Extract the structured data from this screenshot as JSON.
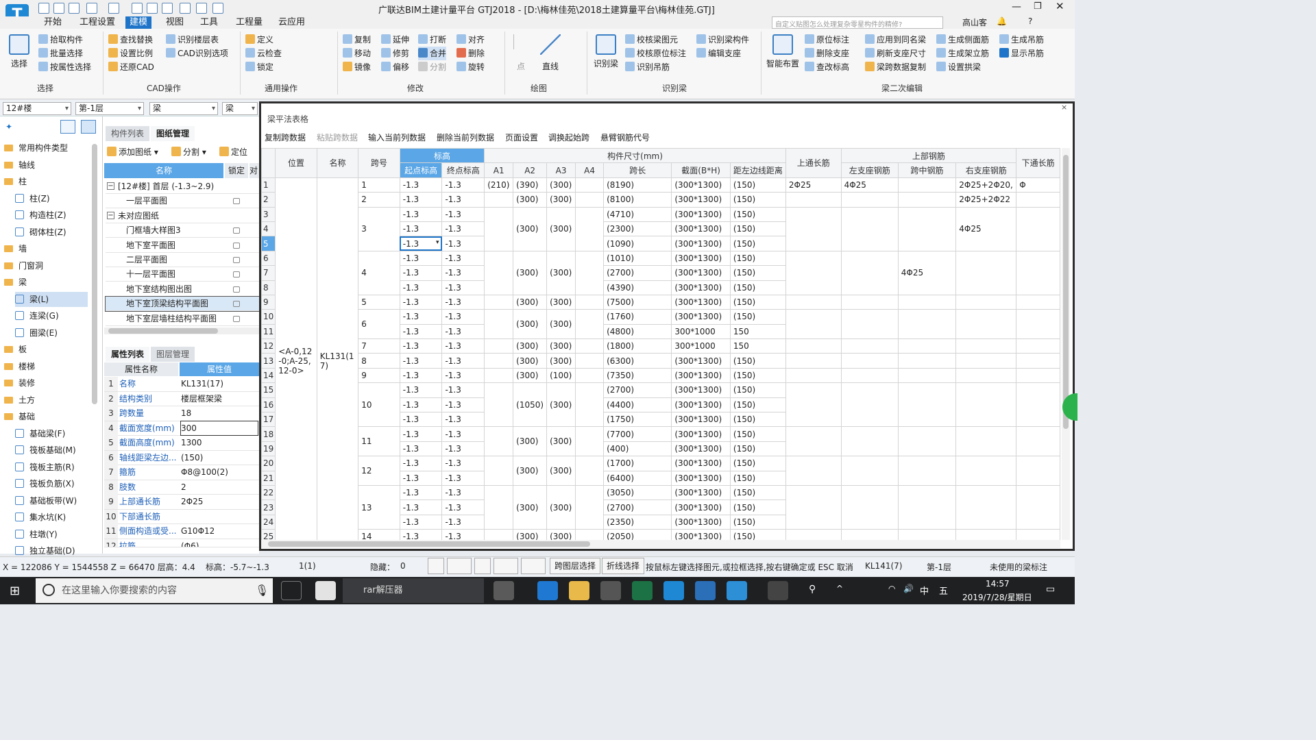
{
  "window": {
    "title": "广联达BIM土建计量平台 GTJ2018 - [D:\\梅林佳苑\\2018土建算量平台\\梅林佳苑.GTJ]",
    "logo": "T",
    "search_placeholder": "自定义贴图怎么处理复杂零星构件的精修?",
    "user": "高山客"
  },
  "menu": [
    "开始",
    "工程设置",
    "建模",
    "视图",
    "工具",
    "工程量",
    "云应用"
  ],
  "ribbon": {
    "select_big": "选择",
    "col1": [
      "拾取构件",
      "批量选择",
      "按属性选择"
    ],
    "col2": [
      "查找替换",
      "设置比例",
      "还原CAD"
    ],
    "col3": [
      "识别楼层表",
      "CAD识别选项"
    ],
    "col4": [
      "定义",
      "云检查",
      "锁定"
    ],
    "col5": [
      "复制",
      "移动",
      "镜像"
    ],
    "col6": [
      "延伸",
      "修剪",
      "偏移"
    ],
    "col7": [
      "打断",
      "合并",
      "分割"
    ],
    "col8": [
      "对齐",
      "删除",
      "旋转"
    ],
    "draw": [
      "点",
      "直线"
    ],
    "recog_beam_big": "识别梁",
    "col9": [
      "校核梁图元",
      "校核原位标注",
      "识别吊筋"
    ],
    "col10": [
      "识别梁构件",
      "编辑支座"
    ],
    "smart_big": "智能布置",
    "col11": [
      "原位标注",
      "删除支座",
      "查改标高"
    ],
    "col12": [
      "应用到同名梁",
      "刷新支座尺寸",
      "梁跨数据复制"
    ],
    "col13": [
      "生成侧面筋",
      "生成架立筋",
      "设置拱梁"
    ],
    "col14": [
      "生成吊筋",
      "显示吊筋"
    ],
    "groups": [
      "选择",
      "CAD操作",
      "通用操作",
      "修改",
      "绘图",
      "识别梁",
      "梁二次编辑"
    ]
  },
  "toolbar": {
    "floor": "12#楼",
    "layer": "第-1层",
    "type": "梁",
    "type2": "梁"
  },
  "tree": [
    {
      "label": "常用构件类型",
      "kind": "folder"
    },
    {
      "label": "轴线",
      "kind": "folder"
    },
    {
      "label": "柱",
      "kind": "folder"
    },
    {
      "label": "柱(Z)",
      "kind": "item"
    },
    {
      "label": "构造柱(Z)",
      "kind": "item"
    },
    {
      "label": "砌体柱(Z)",
      "kind": "item"
    },
    {
      "label": "墙",
      "kind": "folder"
    },
    {
      "label": "门窗洞",
      "kind": "folder"
    },
    {
      "label": "梁",
      "kind": "folder"
    },
    {
      "label": "梁(L)",
      "kind": "item",
      "selected": true
    },
    {
      "label": "连梁(G)",
      "kind": "item"
    },
    {
      "label": "圈梁(E)",
      "kind": "item"
    },
    {
      "label": "板",
      "kind": "folder"
    },
    {
      "label": "楼梯",
      "kind": "folder"
    },
    {
      "label": "装修",
      "kind": "folder"
    },
    {
      "label": "土方",
      "kind": "folder"
    },
    {
      "label": "基础",
      "kind": "folder"
    },
    {
      "label": "基础梁(F)",
      "kind": "item"
    },
    {
      "label": "筏板基础(M)",
      "kind": "item"
    },
    {
      "label": "筏板主筋(R)",
      "kind": "item"
    },
    {
      "label": "筏板负筋(X)",
      "kind": "item"
    },
    {
      "label": "基础板带(W)",
      "kind": "item"
    },
    {
      "label": "集水坑(K)",
      "kind": "item"
    },
    {
      "label": "柱墩(Y)",
      "kind": "item"
    },
    {
      "label": "独立基础(D)",
      "kind": "item"
    }
  ],
  "drawings": {
    "tabs": [
      "构件列表",
      "图纸管理"
    ],
    "actions": [
      "添加图纸",
      "分割",
      "定位"
    ],
    "headers": [
      "名称",
      "锁定",
      "对"
    ],
    "rows": [
      {
        "label": "[12#楼] 首层 (-1.3~2.9)",
        "group": true
      },
      {
        "label": "一层平面图"
      },
      {
        "label": "未对应图纸",
        "group": true
      },
      {
        "label": "门框墙大样图3"
      },
      {
        "label": "地下室平面图"
      },
      {
        "label": "二层平面图"
      },
      {
        "label": "十一层平面图"
      },
      {
        "label": "地下室结构图出图"
      },
      {
        "label": "地下室顶梁结构平面图"
      },
      {
        "label": "地下室层墙柱结构平面图"
      }
    ]
  },
  "props": {
    "tabs": [
      "属性列表",
      "图层管理"
    ],
    "headers": [
      "属性名称",
      "属性值"
    ],
    "rows": [
      {
        "n": "1",
        "k": "名称",
        "v": "KL131(17)"
      },
      {
        "n": "2",
        "k": "结构类别",
        "v": "楼层框架梁"
      },
      {
        "n": "3",
        "k": "跨数量",
        "v": "18"
      },
      {
        "n": "4",
        "k": "截面宽度(mm)",
        "v": "300"
      },
      {
        "n": "5",
        "k": "截面高度(mm)",
        "v": "1300"
      },
      {
        "n": "6",
        "k": "轴线距梁左边...",
        "v": "(150)"
      },
      {
        "n": "7",
        "k": "箍筋",
        "v": "Φ8@100(2)"
      },
      {
        "n": "8",
        "k": "肢数",
        "v": "2"
      },
      {
        "n": "9",
        "k": "上部通长筋",
        "v": "2Φ25"
      },
      {
        "n": "10",
        "k": "下部通长筋",
        "v": ""
      },
      {
        "n": "11",
        "k": "侧面构造或受...",
        "v": "G10Φ12"
      },
      {
        "n": "12",
        "k": "拉筋",
        "v": "(Φ6)"
      }
    ]
  },
  "dialog": {
    "title": "梁平法表格",
    "buttons": [
      "复制跨数据",
      "粘贴跨数据",
      "输入当前列数据",
      "删除当前列数据",
      "页面设置",
      "调换起始跨",
      "悬臂钢筋代号"
    ],
    "header1": {
      "pos": "位置",
      "name": "名称",
      "span": "跨号",
      "elev": "标高",
      "dims": "构件尺寸(mm)",
      "top_long": "上通长筋",
      "top_rebar": "上部钢筋"
    },
    "header2": [
      "起点标高",
      "终点标高",
      "A1",
      "A2",
      "A3",
      "A4",
      "跨长",
      "截面(B*H)",
      "距左边线距离",
      "左支座钢筋",
      "跨中钢筋",
      "右支座钢筋",
      "下通长筋"
    ],
    "position": "<A-0,12-0;A-25,12-0>",
    "beam_name": "KL131(17)",
    "rows": [
      {
        "r": "1",
        "span": "1",
        "s": "-1.3",
        "e": "-1.3",
        "a1": "(210)",
        "a2": "(390)",
        "a3": "(300)",
        "len": "(8190)",
        "sec": "(300*1300)",
        "dist": "(150)",
        "tl": "2Φ25",
        "ls": "4Φ25",
        "mid": "",
        "rs": "2Φ25+2Φ20,",
        "bl": "Φ"
      },
      {
        "r": "2",
        "span": "2",
        "s": "-1.3",
        "e": "-1.3",
        "a2": "(300)",
        "a3": "(300)",
        "len": "(8100)",
        "sec": "(300*1300)",
        "dist": "(150)",
        "rs": "2Φ25+2Φ22"
      },
      {
        "r": "3",
        "s": "-1.3",
        "e": "-1.3",
        "len": "(4710)",
        "sec": "(300*1300)",
        "dist": "(150)"
      },
      {
        "r": "4",
        "span": "3",
        "s": "-1.3",
        "e": "-1.3",
        "a2": "(300)",
        "a3": "(300)",
        "len": "(2300)",
        "sec": "(300*1300)",
        "dist": "(150)",
        "rs": "4Φ25"
      },
      {
        "r": "5",
        "s": "-1.3",
        "e": "-1.3",
        "len": "(1090)",
        "sec": "(300*1300)",
        "dist": "(150)",
        "editing": true
      },
      {
        "r": "6",
        "s": "-1.3",
        "e": "-1.3",
        "len": "(1010)",
        "sec": "(300*1300)",
        "dist": "(150)"
      },
      {
        "r": "7",
        "span": "4",
        "s": "-1.3",
        "e": "-1.3",
        "a2": "(300)",
        "a3": "(300)",
        "len": "(2700)",
        "sec": "(300*1300)",
        "dist": "(150)",
        "mid": "4Φ25"
      },
      {
        "r": "8",
        "s": "-1.3",
        "e": "-1.3",
        "len": "(4390)",
        "sec": "(300*1300)",
        "dist": "(150)"
      },
      {
        "r": "9",
        "span": "5",
        "s": "-1.3",
        "e": "-1.3",
        "a2": "(300)",
        "a3": "(300)",
        "len": "(7500)",
        "sec": "(300*1300)",
        "dist": "(150)"
      },
      {
        "r": "10",
        "s": "-1.3",
        "e": "-1.3",
        "len": "(1760)",
        "sec": "(300*1300)",
        "dist": "(150)"
      },
      {
        "r": "11",
        "span": "6",
        "s": "-1.3",
        "e": "-1.3",
        "a2": "(300)",
        "a3": "(300)",
        "len": "(4800)",
        "sec": "300*1000",
        "dist": "150"
      },
      {
        "r": "12",
        "span": "7",
        "s": "-1.3",
        "e": "-1.3",
        "a2": "(300)",
        "a3": "(300)",
        "len": "(1800)",
        "sec": "300*1000",
        "dist": "150"
      },
      {
        "r": "13",
        "span": "8",
        "s": "-1.3",
        "e": "-1.3",
        "a2": "(300)",
        "a3": "(300)",
        "len": "(6300)",
        "sec": "(300*1300)",
        "dist": "(150)"
      },
      {
        "r": "14",
        "span": "9",
        "s": "-1.3",
        "e": "-1.3",
        "a2": "(300)",
        "a3": "(100)",
        "len": "(7350)",
        "sec": "(300*1300)",
        "dist": "(150)"
      },
      {
        "r": "15",
        "s": "-1.3",
        "e": "-1.3",
        "len": "(2700)",
        "sec": "(300*1300)",
        "dist": "(150)"
      },
      {
        "r": "16",
        "span": "10",
        "s": "-1.3",
        "e": "-1.3",
        "a2": "(1050)",
        "a3": "(300)",
        "len": "(4400)",
        "sec": "(300*1300)",
        "dist": "(150)"
      },
      {
        "r": "17",
        "s": "-1.3",
        "e": "-1.3",
        "len": "(1750)",
        "sec": "(300*1300)",
        "dist": "(150)"
      },
      {
        "r": "18",
        "s": "-1.3",
        "e": "-1.3",
        "len": "(7700)",
        "sec": "(300*1300)",
        "dist": "(150)"
      },
      {
        "r": "19",
        "span": "11",
        "s": "-1.3",
        "e": "-1.3",
        "a2": "(300)",
        "a3": "(300)",
        "len": "(400)",
        "sec": "(300*1300)",
        "dist": "(150)"
      },
      {
        "r": "20",
        "s": "-1.3",
        "e": "-1.3",
        "len": "(1700)",
        "sec": "(300*1300)",
        "dist": "(150)"
      },
      {
        "r": "21",
        "span": "12",
        "s": "-1.3",
        "e": "-1.3",
        "a2": "(300)",
        "a3": "(300)",
        "len": "(6400)",
        "sec": "(300*1300)",
        "dist": "(150)"
      },
      {
        "r": "22",
        "s": "-1.3",
        "e": "-1.3",
        "len": "(3050)",
        "sec": "(300*1300)",
        "dist": "(150)"
      },
      {
        "r": "23",
        "span": "13",
        "s": "-1.3",
        "e": "-1.3",
        "a2": "(300)",
        "a3": "(300)",
        "len": "(2700)",
        "sec": "(300*1300)",
        "dist": "(150)"
      },
      {
        "r": "24",
        "s": "-1.3",
        "e": "-1.3",
        "len": "(2350)",
        "sec": "(300*1300)",
        "dist": "(150)"
      },
      {
        "r": "25",
        "span": "14",
        "s": "-1.3",
        "e": "-1.3",
        "a2": "(300)",
        "a3": "(300)",
        "len": "(2050)",
        "sec": "(300*1300)",
        "dist": "(150)"
      }
    ]
  },
  "status": {
    "coords": "X = 122086 Y = 1544558 Z = 66470 层高：4.4",
    "elev": "标高：-5.7~-1.3",
    "count": "1(1)",
    "hidden": "隐藏：",
    "hidden_val": "0",
    "btn_span": "跨图层选择",
    "btn_poly": "折线选择",
    "hint": "按鼠标左键选择图元,或拉框选择,按右键确定或 ESC 取消",
    "beam": "KL141(7)",
    "layer": "第-1层",
    "unused": "未使用的梁标注"
  },
  "taskbar": {
    "search": "在这里输入你要搜索的内容",
    "app": "rar解压器",
    "time": "14:57",
    "date": "2019/7/28/星期日",
    "ime": "中",
    "ime2": "五"
  }
}
